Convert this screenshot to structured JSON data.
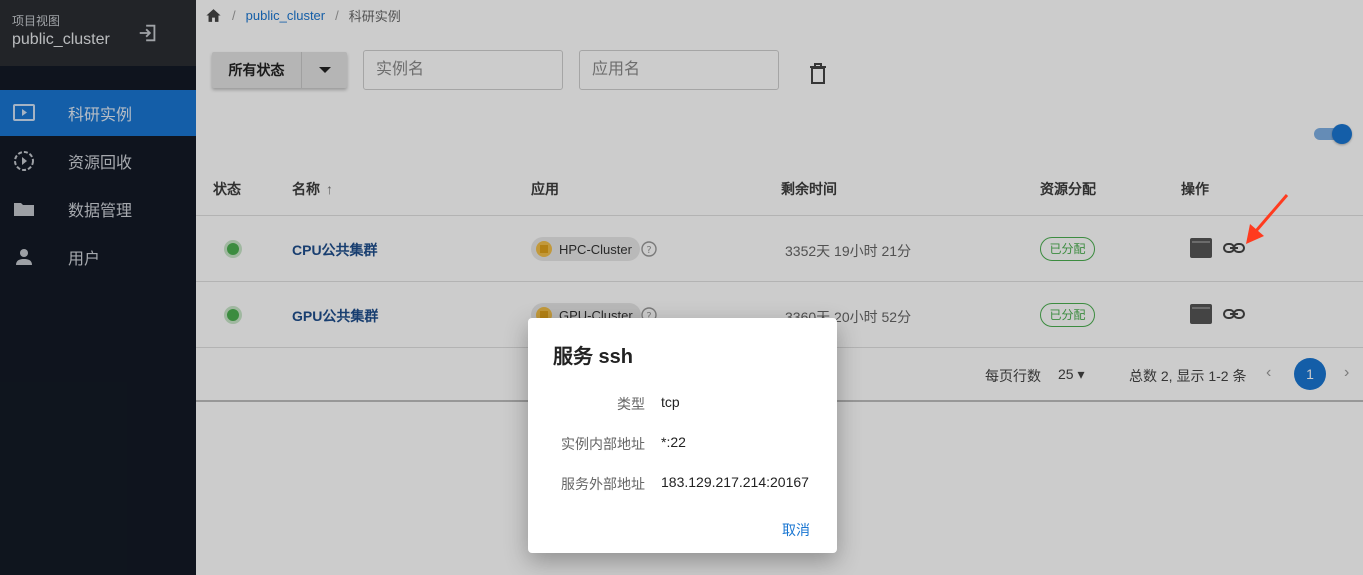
{
  "sidebar": {
    "subtitle": "项目视图",
    "project": "public_cluster",
    "items": [
      {
        "label": "科研实例",
        "icon": "monitor-play-icon",
        "active": true
      },
      {
        "label": "资源回收",
        "icon": "recycle-icon",
        "active": false
      },
      {
        "label": "数据管理",
        "icon": "folder-icon",
        "active": false
      },
      {
        "label": "用户",
        "icon": "person-icon",
        "active": false
      }
    ]
  },
  "breadcrumb": {
    "home_icon": "home-icon",
    "project": "public_cluster",
    "current": "科研实例"
  },
  "toolbar": {
    "status_filter": "所有状态",
    "instance_placeholder": "实例名",
    "app_placeholder": "应用名",
    "toggle_on": true
  },
  "table": {
    "columns": [
      "状态",
      "名称",
      "应用",
      "剩余时间",
      "资源分配",
      "操作"
    ],
    "sort_column": "名称",
    "sort_icon": "↑",
    "rows": [
      {
        "status": "running",
        "name": "CPU公共集群",
        "app": "HPC-Cluster",
        "remaining": "3352天 19小时 21分",
        "allocation": "已分配"
      },
      {
        "status": "running",
        "name": "GPU公共集群",
        "app": "GPU-Cluster",
        "remaining": "3360天 20小时 52分",
        "allocation": "已分配"
      }
    ]
  },
  "pagination": {
    "rows_per_page_label": "每页行数",
    "rows_per_page": "25",
    "total_text": "总数 2,  显示  1-2 条",
    "current_page": "1",
    "prev": "‹",
    "next": "›"
  },
  "dialog": {
    "title": "服务 ssh",
    "fields": [
      {
        "label": "类型",
        "value": "tcp"
      },
      {
        "label": "实例内部地址",
        "value": "*:22"
      },
      {
        "label": "服务外部地址",
        "value": "183.129.217.214:20167"
      }
    ],
    "cancel": "取消"
  },
  "colors": {
    "sidebar_bg": "#131a26",
    "accent": "#1976d2",
    "status_green": "#4caf50",
    "annotation_red": "#ff3b1f"
  }
}
